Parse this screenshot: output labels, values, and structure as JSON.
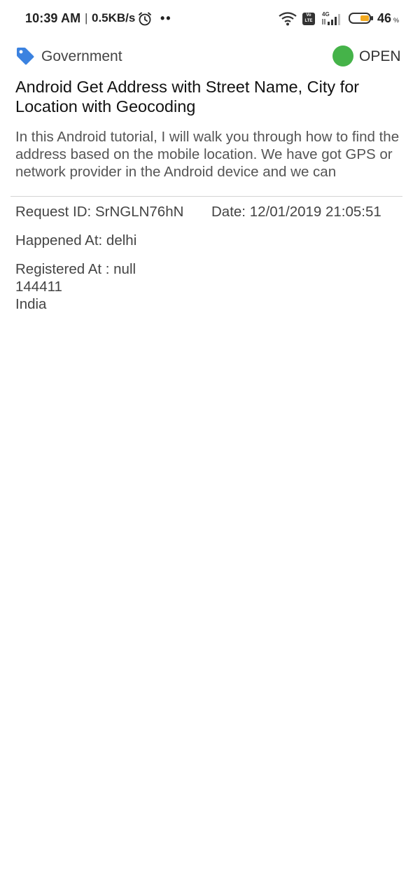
{
  "status_bar": {
    "time": "10:39 AM",
    "separator": "|",
    "speed": "0.5KB/s",
    "dots": "••",
    "volte_line1": "Vo",
    "volte_line2": "LTE",
    "network": "4G",
    "battery_level": "46",
    "battery_unit": "%",
    "icons": [
      "alarm-icon",
      "wifi-icon",
      "volte-icon",
      "signal-icon",
      "battery-icon"
    ]
  },
  "request": {
    "category": "Government",
    "category_icon": "tag-icon",
    "status": "OPEN",
    "status_color": "#45b349",
    "title": "Android Get Address with Street Name, City for Location with Geocoding",
    "excerpt": "In this Android tutorial, I will walk you through how to find the address based on the mobile location. We have got GPS or network provider in the Android device and we can",
    "request_id": "Request ID: SrNGLN76hN",
    "date": "Date: 12/01/2019 21:05:51",
    "happened_at": "Happened At: delhi",
    "registered_at": {
      "line1": "Registered At : null",
      "line2": "144411",
      "line3": "India"
    }
  },
  "colors": {
    "accent": "#3b82e0",
    "status_open": "#45b349",
    "battery": "#f2a91f"
  }
}
